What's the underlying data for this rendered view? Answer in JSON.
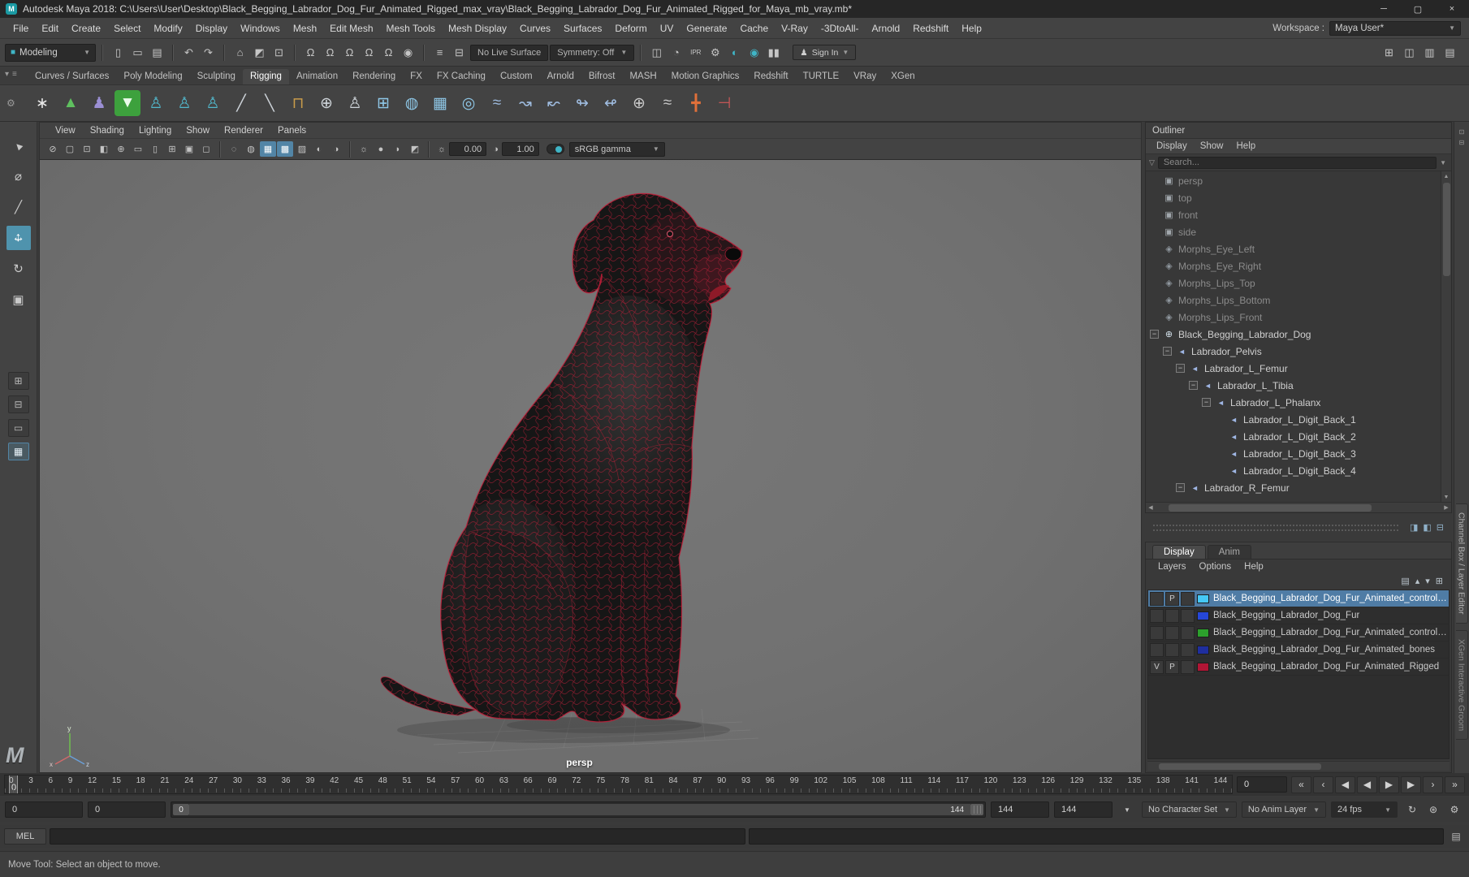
{
  "colors": {
    "accent": "#5285a6",
    "selection": "#4f7ca5",
    "wireframe_red": "#c41f3a",
    "viewport_gray": "#717171"
  },
  "titlebar": {
    "app_glyph": "M",
    "title": "Autodesk Maya 2018: C:\\Users\\User\\Desktop\\Black_Begging_Labrador_Dog_Fur_Animated_Rigged_max_vray\\Black_Begging_Labrador_Dog_Fur_Animated_Rigged_for_Maya_mb_vray.mb*",
    "window_buttons": [
      {
        "name": "minimize-button",
        "glyph": "─"
      },
      {
        "name": "restore-button",
        "glyph": "▢"
      },
      {
        "name": "close-button",
        "glyph": "×"
      }
    ]
  },
  "menubar": {
    "items": [
      "File",
      "Edit",
      "Create",
      "Select",
      "Modify",
      "Display",
      "Windows",
      "Mesh",
      "Edit Mesh",
      "Mesh Tools",
      "Mesh Display",
      "Curves",
      "Surfaces",
      "Deform",
      "UV",
      "Generate",
      "Cache",
      "V-Ray",
      "-3DtoAll-",
      "Arnold",
      "Redshift",
      "Help"
    ],
    "workspace_label": "Workspace :",
    "workspace_value": "Maya User*"
  },
  "toolbar": {
    "mode_selector": {
      "label": "Modeling",
      "icon_glyph": "■"
    },
    "groups": {
      "file": [
        {
          "name": "new-scene-icon",
          "glyph": "▯"
        },
        {
          "name": "open-scene-icon",
          "glyph": "▭"
        },
        {
          "name": "save-scene-icon",
          "glyph": "▤"
        }
      ],
      "edit": [
        {
          "name": "undo-icon",
          "glyph": "↶"
        },
        {
          "name": "redo-icon",
          "glyph": "↷"
        }
      ],
      "selection": [
        {
          "name": "select-by-hierarchy-icon",
          "glyph": "⌂"
        },
        {
          "name": "select-by-object-icon",
          "glyph": "◩"
        },
        {
          "name": "select-by-component-icon",
          "glyph": "⊡"
        }
      ],
      "snap": [
        {
          "name": "snap-to-grid-icon",
          "glyph": "Ω"
        },
        {
          "name": "snap-to-curve-icon",
          "glyph": "Ω"
        },
        {
          "name": "snap-to-point-icon",
          "glyph": "Ω"
        },
        {
          "name": "snap-to-projected-center-icon",
          "glyph": "Ω"
        },
        {
          "name": "snap-to-view-plane-icon",
          "glyph": "Ω"
        },
        {
          "name": "make-live-icon",
          "glyph": "◉"
        }
      ],
      "history": [
        {
          "name": "construction-history-icon",
          "glyph": "≡"
        },
        {
          "name": "input-operations-icon",
          "glyph": "⊟"
        }
      ],
      "render": [
        {
          "name": "render-view-icon",
          "glyph": "◫"
        },
        {
          "name": "render-current-frame-icon",
          "glyph": "◔"
        },
        {
          "name": "ipr-render-icon",
          "glyph": "IPR"
        },
        {
          "name": "render-settings-icon",
          "glyph": "⚙"
        },
        {
          "name": "hypershade-icon",
          "glyph": "◐",
          "color": "#3fb5c6"
        },
        {
          "name": "render-setup-icon",
          "glyph": "◉",
          "color": "#3fb5c6"
        },
        {
          "name": "pause-viewport-icon",
          "glyph": "▮▮"
        }
      ]
    },
    "live_surface": "No Live Surface",
    "symmetry": "Symmetry: Off",
    "sign_in_label": "Sign In",
    "sign_in_icon": "♟",
    "right_icons": [
      {
        "name": "single-pane-view-icon",
        "glyph": "⊞"
      },
      {
        "name": "two-pane-view-icon",
        "glyph": "◫"
      },
      {
        "name": "three-pane-view-icon",
        "glyph": "▥"
      },
      {
        "name": "four-pane-view-icon",
        "glyph": "▤"
      }
    ]
  },
  "shelf": {
    "gear_icon": "⚙",
    "tab_menu_icons": [
      {
        "name": "shelf-tab-menu-icon",
        "glyph": "▾"
      },
      {
        "name": "shelf-options-icon",
        "glyph": "≡"
      }
    ],
    "tabs": [
      {
        "label": "Curves / Surfaces",
        "active": false
      },
      {
        "label": "Poly Modeling",
        "active": false
      },
      {
        "label": "Sculpting",
        "active": false
      },
      {
        "label": "Rigging",
        "active": true
      },
      {
        "label": "Animation",
        "active": false
      },
      {
        "label": "Rendering",
        "active": false
      },
      {
        "label": "FX",
        "active": false
      },
      {
        "label": "FX Caching",
        "active": false
      },
      {
        "label": "Custom",
        "active": false
      },
      {
        "label": "Arnold",
        "active": false
      },
      {
        "label": "Bifrost",
        "active": false
      },
      {
        "label": "MASH",
        "active": false
      },
      {
        "label": "Motion Graphics",
        "active": false
      },
      {
        "label": "Redshift",
        "active": false
      },
      {
        "label": "TURTLE",
        "active": false
      },
      {
        "label": "VRay",
        "active": false
      },
      {
        "label": "XGen",
        "active": false
      }
    ],
    "icons": [
      {
        "name": "joint-size-icon",
        "glyph": "∗",
        "color": "#e8e8e8"
      },
      {
        "name": "create-joint-icon",
        "glyph": "▲",
        "color": "#5fc05f"
      },
      {
        "name": "ik-handle-icon",
        "glyph": "♟",
        "color": "#9b8fd4"
      },
      {
        "name": "bind-skin-icon",
        "glyph": "▼",
        "color": "#eafbea",
        "bg": "#3da13d"
      },
      {
        "name": "parent-constraint-icon",
        "glyph": "♙",
        "color": "#52b8cc"
      },
      {
        "name": "point-constraint-icon",
        "glyph": "♙",
        "color": "#52b8cc"
      },
      {
        "name": "orient-constraint-icon",
        "glyph": "♙",
        "color": "#52b8cc"
      },
      {
        "name": "paint-skin-weights-icon",
        "glyph": "╱",
        "color": "#ccd2d8"
      },
      {
        "name": "mirror-skin-weights-icon",
        "glyph": "╲",
        "color": "#ccd2d8"
      },
      {
        "name": "copy-skin-weights-icon",
        "glyph": "⊓",
        "color": "#c89b4a"
      },
      {
        "name": "edit-membership-icon",
        "glyph": "⊕",
        "color": "#cfd5da"
      },
      {
        "name": "component-editor-icon",
        "glyph": "♙",
        "color": "#cfd5da"
      },
      {
        "name": "lattice-icon",
        "glyph": "⊞",
        "color": "#8fc8e8"
      },
      {
        "name": "lattice-sphere-icon",
        "glyph": "◍",
        "color": "#8fc8e8"
      },
      {
        "name": "wrap-deformer-icon",
        "glyph": "▦",
        "color": "#8fc8e8"
      },
      {
        "name": "cluster-icon",
        "glyph": "◎",
        "color": "#8fc8e8"
      },
      {
        "name": "curve-warp-icon",
        "glyph": "≈",
        "color": "#9fbce0"
      },
      {
        "name": "wire-tool-icon",
        "glyph": "↝",
        "color": "#9fbce0"
      },
      {
        "name": "shrink-wrap-icon",
        "glyph": "↜",
        "color": "#9fbce0"
      },
      {
        "name": "sculpt-deformer-icon",
        "glyph": "↬",
        "color": "#9fbce0"
      },
      {
        "name": "texture-deformer-icon",
        "glyph": "↫",
        "color": "#9fbce0"
      },
      {
        "name": "pose-interpolator-icon",
        "glyph": "⊕",
        "color": "#c8c8c8"
      },
      {
        "name": "blend-shape-icon",
        "glyph": "≈",
        "color": "#c8c8c8"
      },
      {
        "name": "mirror-joint-icon",
        "glyph": "╋",
        "color": "#e0703a"
      },
      {
        "name": "remove-joint-icon",
        "glyph": "⊣",
        "color": "#d05858"
      }
    ]
  },
  "tool_column": {
    "tools": [
      {
        "k": "select-tool",
        "glyph": "▲",
        "active": false
      },
      {
        "k": "lasso-tool",
        "glyph": "⌀",
        "active": false
      },
      {
        "k": "paint-select-tool",
        "glyph": "╱",
        "active": false
      },
      {
        "k": "move-tool",
        "glyph": "",
        "active": true
      },
      {
        "k": "rotate-tool",
        "glyph": "↻",
        "active": false
      },
      {
        "k": "scale-tool",
        "glyph": "▣",
        "active": false
      }
    ],
    "layouts": [
      {
        "name": "quick-layout-widget-1",
        "glyph": "⊞",
        "active": false
      },
      {
        "name": "quick-layout-widget-2",
        "glyph": "⊟",
        "active": false
      },
      {
        "name": "single-pane-layout-button",
        "glyph": "▭",
        "active": false
      },
      {
        "name": "four-pane-layout-button",
        "glyph": "▦",
        "active": true
      }
    ],
    "logo_glyph": "M"
  },
  "viewport": {
    "menus": [
      "View",
      "Shading",
      "Lighting",
      "Show",
      "Renderer",
      "Panels"
    ],
    "bar": {
      "group_a": [
        {
          "name": "select-camera-icon",
          "glyph": "⊘"
        },
        {
          "name": "camera-attributes-icon",
          "glyph": "▢"
        },
        {
          "name": "bookmarks-icon",
          "glyph": "⊡"
        },
        {
          "name": "image-plane-icon",
          "glyph": "◧"
        },
        {
          "name": "two-d-pan-zoom-icon",
          "glyph": "⊕"
        },
        {
          "name": "film-gate-icon",
          "glyph": "▭"
        },
        {
          "name": "resolution-gate-icon",
          "glyph": "▯"
        },
        {
          "name": "field-chart-icon",
          "glyph": "⊞"
        },
        {
          "name": "safe-action-icon",
          "glyph": "▣"
        },
        {
          "name": "safe-title-icon",
          "glyph": "◻"
        }
      ],
      "group_b": [
        {
          "name": "wireframe-icon",
          "glyph": "◌",
          "active": false
        },
        {
          "name": "smooth-shade-icon",
          "glyph": "◍",
          "active": false
        },
        {
          "name": "wireframe-on-shaded-icon",
          "glyph": "▦",
          "active": true
        },
        {
          "name": "textured-icon",
          "glyph": "▩",
          "active": true
        },
        {
          "name": "use-default-material-icon",
          "glyph": "▨",
          "active": false
        },
        {
          "name": "xray-icon",
          "glyph": "◐",
          "active": false
        },
        {
          "name": "joint-xray-icon",
          "glyph": "◑",
          "active": false
        }
      ],
      "group_c": [
        {
          "name": "lighting-icon",
          "glyph": "☼"
        },
        {
          "name": "shadows-icon",
          "glyph": "●"
        },
        {
          "name": "occlusion-icon",
          "glyph": "◗"
        },
        {
          "name": "anti-alias-icon",
          "glyph": "◩"
        }
      ],
      "exposure_icon": "☼",
      "exposure": "0.00",
      "gamma_icon": "◑",
      "gamma": "1.00",
      "colorspace": "sRGB gamma"
    },
    "camera_label": "persp",
    "axis_labels": {
      "x": "x",
      "y": "y",
      "z": "z"
    }
  },
  "outliner": {
    "title": "Outliner",
    "menus": [
      "Display",
      "Show",
      "Help"
    ],
    "search_placeholder": "Search...",
    "items": [
      {
        "label": "persp",
        "depth": 0,
        "icon": "camera",
        "state": "leaf",
        "muted": true
      },
      {
        "label": "top",
        "depth": 0,
        "icon": "camera",
        "state": "leaf",
        "muted": true
      },
      {
        "label": "front",
        "depth": 0,
        "icon": "camera",
        "state": "leaf",
        "muted": true
      },
      {
        "label": "side",
        "depth": 0,
        "icon": "camera",
        "state": "leaf",
        "muted": true
      },
      {
        "label": "Morphs_Eye_Left",
        "depth": 0,
        "icon": "morph",
        "state": "leaf",
        "muted": true
      },
      {
        "label": "Morphs_Eye_Right",
        "depth": 0,
        "icon": "morph",
        "state": "leaf",
        "muted": true
      },
      {
        "label": "Morphs_Lips_Top",
        "depth": 0,
        "icon": "morph",
        "state": "leaf",
        "muted": true
      },
      {
        "label": "Morphs_Lips_Bottom",
        "depth": 0,
        "icon": "morph",
        "state": "leaf",
        "muted": true
      },
      {
        "label": "Morphs_Lips_Front",
        "depth": 0,
        "icon": "morph",
        "state": "leaf",
        "muted": true
      },
      {
        "label": "Black_Begging_Labrador_Dog",
        "depth": 0,
        "icon": "group",
        "state": "expanded",
        "muted": false
      },
      {
        "label": "Labrador_Pelvis",
        "depth": 1,
        "icon": "joint",
        "state": "expanded",
        "muted": false
      },
      {
        "label": "Labrador_L_Femur",
        "depth": 2,
        "icon": "joint",
        "state": "expanded",
        "muted": false
      },
      {
        "label": "Labrador_L_Tibia",
        "depth": 3,
        "icon": "joint",
        "state": "expanded",
        "muted": false
      },
      {
        "label": "Labrador_L_Phalanx",
        "depth": 4,
        "icon": "joint",
        "state": "expanded",
        "muted": false
      },
      {
        "label": "Labrador_L_Digit_Back_1",
        "depth": 5,
        "icon": "joint",
        "state": "leaf",
        "muted": false
      },
      {
        "label": "Labrador_L_Digit_Back_2",
        "depth": 5,
        "icon": "joint",
        "state": "leaf",
        "muted": false
      },
      {
        "label": "Labrador_L_Digit_Back_3",
        "depth": 5,
        "icon": "joint",
        "state": "leaf",
        "muted": false
      },
      {
        "label": "Labrador_L_Digit_Back_4",
        "depth": 5,
        "icon": "joint",
        "state": "leaf",
        "muted": false
      },
      {
        "label": "Labrador_R_Femur",
        "depth": 2,
        "icon": "joint",
        "state": "expanded",
        "muted": false
      }
    ]
  },
  "separator": {
    "icons": [
      {
        "name": "channel-box-toggle-icon",
        "glyph": "◨"
      },
      {
        "name": "layer-editor-toggle-icon",
        "glyph": "◧"
      },
      {
        "name": "split-panel-icon",
        "glyph": "⊟"
      }
    ]
  },
  "layer_editor": {
    "tabs": [
      {
        "label": "Display",
        "active": true
      },
      {
        "label": "Anim",
        "active": false
      }
    ],
    "menus": [
      "Layers",
      "Options",
      "Help"
    ],
    "icons": [
      {
        "name": "layers-sort-icon",
        "glyph": "▤"
      },
      {
        "name": "move-layer-up-icon",
        "glyph": "▴"
      },
      {
        "name": "move-layer-down-icon",
        "glyph": "▾"
      },
      {
        "name": "create-empty-layer-icon",
        "glyph": "⊞"
      }
    ],
    "layers": [
      {
        "v": "",
        "p": "P",
        "color": "#45c8f5",
        "name": "Black_Begging_Labrador_Dog_Fur_Animated_controllers",
        "selected": true
      },
      {
        "v": "",
        "p": "",
        "color": "#2647d8",
        "name": "Black_Begging_Labrador_Dog_Fur",
        "selected": false
      },
      {
        "v": "",
        "p": "",
        "color": "#2ca02c",
        "name": "Black_Begging_Labrador_Dog_Fur_Animated_controllers_freeze",
        "selected": false
      },
      {
        "v": "",
        "p": "",
        "color": "#1f2e9e",
        "name": "Black_Begging_Labrador_Dog_Fur_Animated_bones",
        "selected": false
      },
      {
        "v": "V",
        "p": "P",
        "color": "#b01535",
        "name": "Black_Begging_Labrador_Dog_Fur_Animated_Rigged",
        "selected": false
      }
    ]
  },
  "panel_strip": {
    "dock_icons": [
      {
        "name": "dock-icon-1",
        "glyph": "⊡"
      },
      {
        "name": "dock-icon-2",
        "glyph": "⊟"
      }
    ],
    "tabs": [
      "Channel Box / Layer Editor",
      "XGen Interactive Groom"
    ]
  },
  "timeline": {
    "ticks": [
      0,
      3,
      6,
      9,
      12,
      15,
      18,
      21,
      24,
      27,
      30,
      33,
      36,
      39,
      42,
      45,
      48,
      51,
      54,
      57,
      60,
      63,
      66,
      69,
      72,
      75,
      78,
      81,
      84,
      87,
      90,
      93,
      96,
      99,
      102,
      105,
      108,
      111,
      114,
      117,
      120,
      123,
      126,
      129,
      132,
      135,
      138,
      141,
      144
    ],
    "marker_label": "0",
    "current_time": "0",
    "playback": [
      {
        "name": "go-to-start-button",
        "glyph": "«"
      },
      {
        "name": "step-back-key-button",
        "glyph": "‹"
      },
      {
        "name": "step-back-frame-button",
        "glyph": "◀"
      },
      {
        "name": "play-backwards-button",
        "glyph": "◀"
      },
      {
        "name": "play-forwards-button",
        "glyph": "▶"
      },
      {
        "name": "step-forward-frame-button",
        "glyph": "▶"
      },
      {
        "name": "step-forward-key-button",
        "glyph": "›"
      },
      {
        "name": "go-to-end-button",
        "glyph": "»"
      }
    ]
  },
  "range": {
    "animation_start": "0",
    "playback_start": "0",
    "range_start_label": "0",
    "range_end_label": "144",
    "playback_end": "144",
    "animation_end": "144",
    "character_set": "No Character Set",
    "anim_layer": "No Anim Layer",
    "fps": "24 fps",
    "icons": [
      {
        "name": "playback-loop-icon",
        "glyph": "↻"
      },
      {
        "name": "auto-keyframe-icon",
        "glyph": "⊛"
      },
      {
        "name": "animation-preferences-icon",
        "glyph": "⚙"
      }
    ]
  },
  "command_line": {
    "label": "MEL",
    "script_editor_icon": "▤"
  },
  "help_line": "Move Tool: Select an object to move."
}
